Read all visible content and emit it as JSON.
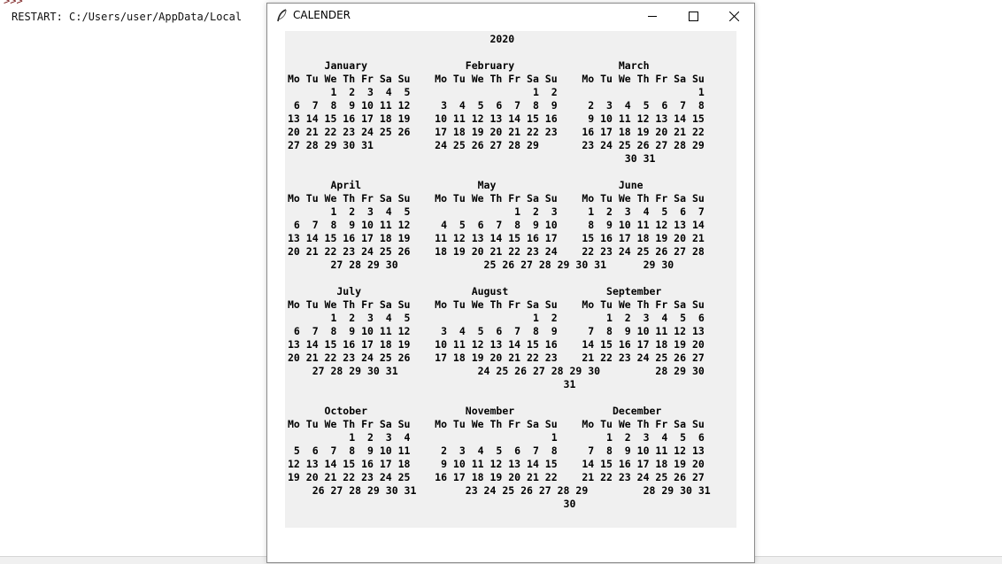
{
  "shell": {
    "prompt": ">>>",
    "restart_line": "RESTART: C:/Users/user/AppData/Local"
  },
  "window": {
    "title": "CALENDER",
    "icons": {
      "app": "feather-icon",
      "minimize": "minimize-icon",
      "maximize": "maximize-icon",
      "close": "close-icon"
    }
  },
  "calendar": {
    "year": "2020",
    "lines": [
      "                                 2020",
      "",
      "      January                February                 March",
      "Mo Tu We Th Fr Sa Su    Mo Tu We Th Fr Sa Su    Mo Tu We Th Fr Sa Su",
      "       1  2  3  4  5                    1  2                       1",
      " 6  7  8  9 10 11 12     3  4  5  6  7  8  9     2  3  4  5  6  7  8",
      "13 14 15 16 17 18 19    10 11 12 13 14 15 16     9 10 11 12 13 14 15",
      "20 21 22 23 24 25 26    17 18 19 20 21 22 23    16 17 18 19 20 21 22",
      "27 28 29 30 31          24 25 26 27 28 29       23 24 25 26 27 28 29",
      "                                                       30 31",
      "",
      "       April                   May                    June",
      "Mo Tu We Th Fr Sa Su    Mo Tu We Th Fr Sa Su    Mo Tu We Th Fr Sa Su",
      "       1  2  3  4  5                 1  2  3     1  2  3  4  5  6  7",
      " 6  7  8  9 10 11 12     4  5  6  7  8  9 10     8  9 10 11 12 13 14",
      "13 14 15 16 17 18 19    11 12 13 14 15 16 17    15 16 17 18 19 20 21",
      "20 21 22 23 24 25 26    18 19 20 21 22 23 24    22 23 24 25 26 27 28",
      "       27 28 29 30              25 26 27 28 29 30 31      29 30",
      "",
      "        July                  August                September",
      "Mo Tu We Th Fr Sa Su    Mo Tu We Th Fr Sa Su    Mo Tu We Th Fr Sa Su",
      "       1  2  3  4  5                    1  2        1  2  3  4  5  6",
      " 6  7  8  9 10 11 12     3  4  5  6  7  8  9     7  8  9 10 11 12 13",
      "13 14 15 16 17 18 19    10 11 12 13 14 15 16    14 15 16 17 18 19 20",
      "20 21 22 23 24 25 26    17 18 19 20 21 22 23    21 22 23 24 25 26 27",
      "    27 28 29 30 31             24 25 26 27 28 29 30         28 29 30",
      "                                             31",
      "",
      "      October                November                December",
      "Mo Tu We Th Fr Sa Su    Mo Tu We Th Fr Sa Su    Mo Tu We Th Fr Sa Su",
      "          1  2  3  4                       1        1  2  3  4  5  6",
      " 5  6  7  8  9 10 11     2  3  4  5  6  7  8     7  8  9 10 11 12 13",
      "12 13 14 15 16 17 18     9 10 11 12 13 14 15    14 15 16 17 18 19 20",
      "19 20 21 22 23 24 25    16 17 18 19 20 21 22    21 22 23 24 25 26 27",
      "    26 27 28 29 30 31        23 24 25 26 27 28 29         28 29 30 31",
      "                                             30"
    ]
  }
}
